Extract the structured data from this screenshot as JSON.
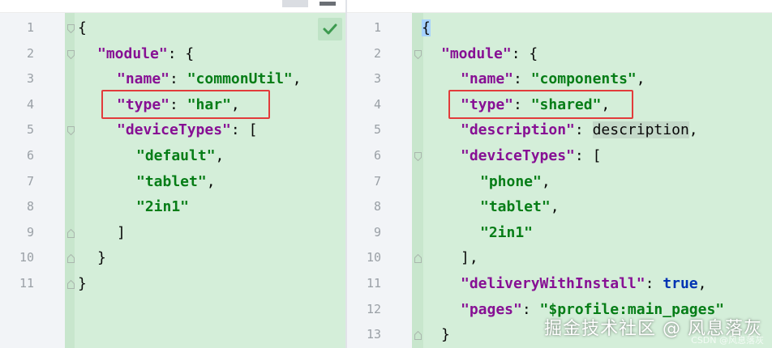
{
  "left_pane": {
    "lines": [
      {
        "n": "1",
        "indent": 0,
        "tokens": [
          {
            "t": "{",
            "c": "p"
          }
        ]
      },
      {
        "n": "2",
        "indent": 1,
        "tokens": [
          {
            "t": "\"module\"",
            "c": "k"
          },
          {
            "t": ": {",
            "c": "p"
          }
        ]
      },
      {
        "n": "3",
        "indent": 2,
        "tokens": [
          {
            "t": "\"name\"",
            "c": "k"
          },
          {
            "t": ": ",
            "c": "p"
          },
          {
            "t": "\"commonUtil\"",
            "c": "s"
          },
          {
            "t": ",",
            "c": "p"
          }
        ]
      },
      {
        "n": "4",
        "indent": 2,
        "tokens": [
          {
            "t": "\"type\"",
            "c": "k"
          },
          {
            "t": ": ",
            "c": "p"
          },
          {
            "t": "\"har\"",
            "c": "s"
          },
          {
            "t": ",",
            "c": "p"
          }
        ]
      },
      {
        "n": "5",
        "indent": 2,
        "tokens": [
          {
            "t": "\"deviceTypes\"",
            "c": "k"
          },
          {
            "t": ": [",
            "c": "p"
          }
        ]
      },
      {
        "n": "6",
        "indent": 3,
        "tokens": [
          {
            "t": "\"default\"",
            "c": "s"
          },
          {
            "t": ",",
            "c": "p"
          }
        ]
      },
      {
        "n": "7",
        "indent": 3,
        "tokens": [
          {
            "t": "\"tablet\"",
            "c": "s"
          },
          {
            "t": ",",
            "c": "p"
          }
        ]
      },
      {
        "n": "8",
        "indent": 3,
        "tokens": [
          {
            "t": "\"2in1\"",
            "c": "s"
          }
        ]
      },
      {
        "n": "9",
        "indent": 2,
        "tokens": [
          {
            "t": "]",
            "c": "p"
          }
        ]
      },
      {
        "n": "10",
        "indent": 1,
        "tokens": [
          {
            "t": "}",
            "c": "p"
          }
        ]
      },
      {
        "n": "11",
        "indent": 0,
        "tokens": [
          {
            "t": "}",
            "c": "p"
          }
        ]
      }
    ]
  },
  "right_pane": {
    "lines": [
      {
        "n": "1",
        "indent": 0,
        "tokens": [
          {
            "t": "{",
            "c": "p cursor-brace"
          }
        ]
      },
      {
        "n": "2",
        "indent": 1,
        "tokens": [
          {
            "t": "\"module\"",
            "c": "k"
          },
          {
            "t": ": {",
            "c": "p"
          }
        ]
      },
      {
        "n": "3",
        "indent": 2,
        "tokens": [
          {
            "t": "\"name\"",
            "c": "k"
          },
          {
            "t": ": ",
            "c": "p"
          },
          {
            "t": "\"components\"",
            "c": "s"
          },
          {
            "t": ",",
            "c": "p"
          }
        ]
      },
      {
        "n": "4",
        "indent": 2,
        "tokens": [
          {
            "t": "\"type\"",
            "c": "k"
          },
          {
            "t": ": ",
            "c": "p"
          },
          {
            "t": "\"shared\"",
            "c": "s"
          },
          {
            "t": ",",
            "c": "p"
          }
        ]
      },
      {
        "n": "5",
        "indent": 2,
        "tokens": [
          {
            "t": "\"description\"",
            "c": "k"
          },
          {
            "t": ": ",
            "c": "p"
          },
          {
            "t": "description",
            "c": "p hl"
          },
          {
            "t": ",",
            "c": "p"
          }
        ]
      },
      {
        "n": "6",
        "indent": 2,
        "tokens": [
          {
            "t": "\"deviceTypes\"",
            "c": "k"
          },
          {
            "t": ": [",
            "c": "p"
          }
        ]
      },
      {
        "n": "7",
        "indent": 3,
        "tokens": [
          {
            "t": "\"phone\"",
            "c": "s"
          },
          {
            "t": ",",
            "c": "p"
          }
        ]
      },
      {
        "n": "8",
        "indent": 3,
        "tokens": [
          {
            "t": "\"tablet\"",
            "c": "s"
          },
          {
            "t": ",",
            "c": "p"
          }
        ]
      },
      {
        "n": "9",
        "indent": 3,
        "tokens": [
          {
            "t": "\"2in1\"",
            "c": "s"
          }
        ]
      },
      {
        "n": "10",
        "indent": 2,
        "tokens": [
          {
            "t": "],",
            "c": "p"
          }
        ]
      },
      {
        "n": "11",
        "indent": 2,
        "tokens": [
          {
            "t": "\"deliveryWithInstall\"",
            "c": "k"
          },
          {
            "t": ": ",
            "c": "p"
          },
          {
            "t": "true",
            "c": "kw"
          },
          {
            "t": ",",
            "c": "p"
          }
        ]
      },
      {
        "n": "12",
        "indent": 2,
        "tokens": [
          {
            "t": "\"pages\"",
            "c": "k"
          },
          {
            "t": ": ",
            "c": "p"
          },
          {
            "t": "\"$profile:main_pages\"",
            "c": "s"
          }
        ]
      },
      {
        "n": "13",
        "indent": 1,
        "tokens": [
          {
            "t": "}",
            "c": "p"
          }
        ]
      }
    ]
  },
  "icons": {
    "status": "check-icon",
    "fold_open": "fold-open-icon",
    "fold_close": "fold-close-icon"
  },
  "colors": {
    "gutter_bg": "#f2f4f7",
    "diff_added_bg": "#d4eed9",
    "json_key": "#871094",
    "json_string": "#067d17",
    "keyword": "#0033b3",
    "highlight_box": "#e23b3b"
  },
  "watermark": {
    "text": "掘金技术社区 @ 风息落灰",
    "sub": "CSDN @风息落灰"
  }
}
